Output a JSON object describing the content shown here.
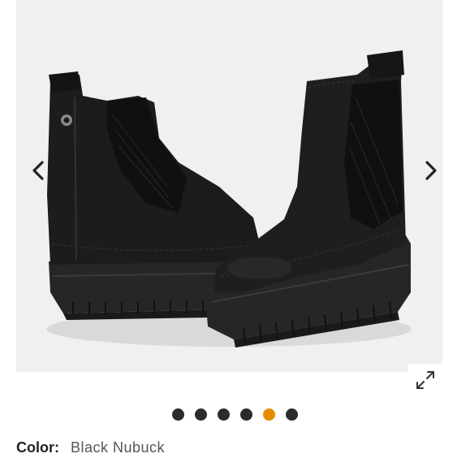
{
  "product_gallery": {
    "image_alt": "Black Nubuck chelsea boots",
    "prev_icon": "chevron-left-icon",
    "next_icon": "chevron-right-icon",
    "expand_icon": "expand-icon",
    "dots": [
      {
        "active": false
      },
      {
        "active": false
      },
      {
        "active": false
      },
      {
        "active": false
      },
      {
        "active": true
      },
      {
        "active": false
      }
    ],
    "active_dot_color": "#e68a00",
    "dot_color": "#2b2b2b"
  },
  "color": {
    "label": "Color:",
    "value": "Black Nubuck"
  }
}
